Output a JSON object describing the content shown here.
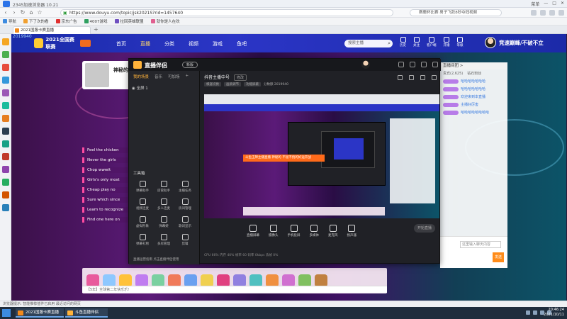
{
  "browser": {
    "title": "2345加速浏览器 10.21",
    "url": "https://www.douyu.com/topic/jsk2021S?rid=1457640",
    "search_placeholder": "赛鹿杯比赛 男子飞跃8秒夺冠视频",
    "window_controls": [
      "菜单",
      "—",
      "□",
      "✕"
    ]
  },
  "favorites": [
    {
      "label": "导航",
      "color": "#3d8be0"
    },
    {
      "label": "下了次的看",
      "color": "#f0a030"
    },
    {
      "label": "京东广告",
      "color": "#e03030"
    },
    {
      "label": "4007游戏",
      "color": "#30a060"
    },
    {
      "label": "拉回英雄联盟",
      "color": "#7050c0"
    },
    {
      "label": "就你是人在欢",
      "color": "#e06090"
    }
  ],
  "tab": {
    "label": "2021国服卡赛直播"
  },
  "site": {
    "year_tag": "2019940",
    "brand": "2021全国赛联赛",
    "nav": [
      "首页",
      "直播",
      "分类",
      "视频",
      "游戏",
      "鱼吧"
    ],
    "search_placeholder": "搜索主播",
    "header_icons": [
      "历史",
      "关注",
      "客户端",
      "开播",
      "等级"
    ],
    "slogan": "竞速巅峰/不破不立"
  },
  "streamer": {
    "name": "神秘的"
  },
  "chat_lines": [
    "Feel the chicken",
    "Never the girls",
    "Chop wwwit",
    "Girls's only most",
    "Cheap play no",
    "Sure which since",
    "Learn to recognize",
    "Find one here on"
  ],
  "right_panel": {
    "header": "直播间团 >",
    "tabs": [
      "贵宾(2,625)",
      "钻石粉丝"
    ],
    "lines": [
      "哈哈哈哈哈哈哈",
      "哈哈哈哈哈哈哈",
      "欢迎来到本直播",
      "主播好厉害",
      "哈哈哈哈哈哈哈哈"
    ],
    "gift_input_placeholder": "这里输入聊天内容",
    "send_label": "发送"
  },
  "gift_bar": {
    "gift_colors": [
      "#e85a9c",
      "#8ec8ff",
      "#ffc23a",
      "#c07cf0",
      "#7ad0a0",
      "#f07a5a",
      "#6aa0f0",
      "#f0d050",
      "#e04080",
      "#9080e0",
      "#50c0c0",
      "#f09040",
      "#d070d0",
      "#80c060",
      "#c08040"
    ],
    "input_text": "【5年】全球第二年快乐乐!"
  },
  "app": {
    "name": "直播伴侣",
    "version": "新版",
    "left_tabs": [
      "我的场景",
      "音乐",
      "可加场"
    ],
    "scene": "全屏 1",
    "tools_title": "工具箱",
    "tools": [
      "弹幕助手",
      "房管助手",
      "主播任务",
      "视频连麦",
      "多人连麦",
      "房间管理",
      "虚拟形象",
      "弹幕姬",
      "歌词显示",
      "弹幕礼物",
      "多房管理",
      "剪辑"
    ],
    "bottom_hint": "直播运营指南 点击直播伴侣使用"
  },
  "main": {
    "title": "抖音主播中号",
    "title_tag": "修改",
    "sub": [
      "横竖切换",
      "画质调节",
      "功能屏蔽"
    ],
    "sub_text": "分数额 2019940",
    "preview_banner": "斗鱼王牌主播直播 神秘的 不屈不挠的好运开战"
  },
  "controls": [
    "直播屏幕",
    "摄像头",
    "手机投屏",
    "多媒体",
    "麦克风",
    "扬声器"
  ],
  "start_label": "开始直播",
  "stats_text": "CPU 66%   内存 40%   帧率 60   码率 0kbps   丢帧 0%",
  "statusbar": "浏览器提示: 智能推荐插件已启用 最近访问的网页",
  "taskbar": {
    "items": [
      {
        "label": "2021国服卡赛直播",
        "color": "#f28a1c"
      },
      {
        "label": "斗鱼直播伴侣",
        "color": "#ffb33a"
      }
    ],
    "time": "20:46:24",
    "date": "2021/10/11"
  }
}
